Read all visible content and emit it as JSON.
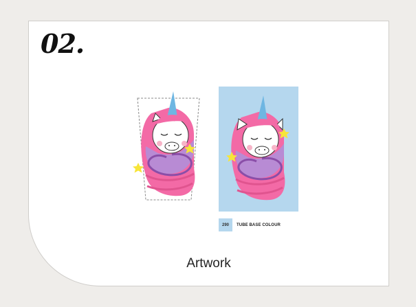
{
  "step_number": "02.",
  "swatch": {
    "code": "290",
    "label": "TUBE BASE COLOUR",
    "color": "#b5d7ee"
  },
  "caption": "Artwork",
  "colors": {
    "page_background": "#efedea",
    "card_background": "#ffffff",
    "mane_pink": "#f36aa6",
    "mane_purple": "#b88bd4",
    "swirl_purple": "#8a4ea8",
    "horn_blue": "#6eb6e2",
    "star_yellow": "#f7e539",
    "cheek_pink": "#f7b5c8"
  }
}
